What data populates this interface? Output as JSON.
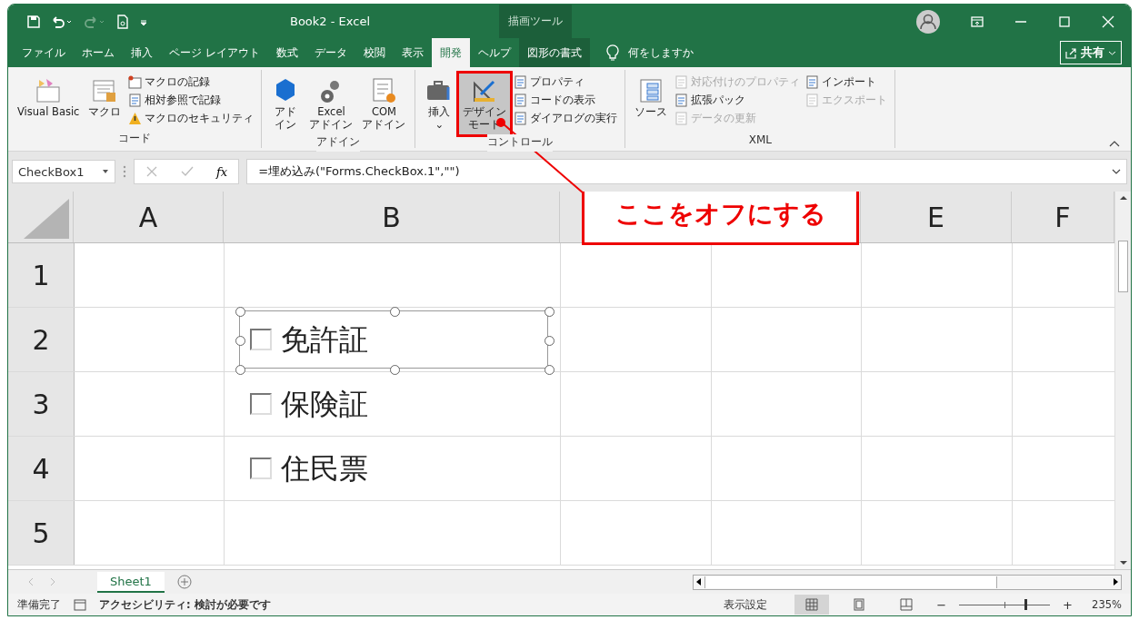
{
  "title_bar": {
    "title": "Book2  -  Excel",
    "context_tab": "描画ツール"
  },
  "menu_tabs": [
    {
      "label": "ファイル",
      "selected": false
    },
    {
      "label": "ホーム",
      "selected": false
    },
    {
      "label": "挿入",
      "selected": false
    },
    {
      "label": "ページ レイアウト",
      "selected": false
    },
    {
      "label": "数式",
      "selected": false
    },
    {
      "label": "データ",
      "selected": false
    },
    {
      "label": "校閲",
      "selected": false
    },
    {
      "label": "表示",
      "selected": false
    },
    {
      "label": "開発",
      "selected": true
    },
    {
      "label": "ヘルプ",
      "selected": false
    },
    {
      "label": "図形の書式",
      "selected": false
    }
  ],
  "tell_me": "何をしますか",
  "share_button": "共有",
  "ribbon": [
    {
      "label": "コード",
      "items": [
        {
          "kind": "large",
          "lines": [
            "Visual Basic"
          ]
        },
        {
          "kind": "large",
          "lines": [
            "マクロ"
          ]
        },
        {
          "kind": "stack",
          "entries": [
            {
              "label": "マクロの記録",
              "disabled": false
            },
            {
              "label": "相対参照で記録",
              "disabled": false
            },
            {
              "label": "マクロのセキュリティ",
              "disabled": false
            }
          ]
        }
      ]
    },
    {
      "label": "アドイン",
      "items": [
        {
          "kind": "large",
          "lines": [
            "アド",
            "イン"
          ]
        },
        {
          "kind": "large",
          "lines": [
            "Excel",
            "アドイン"
          ]
        },
        {
          "kind": "large",
          "lines": [
            "COM",
            "アドイン"
          ]
        }
      ]
    },
    {
      "label": "コントロール",
      "items": [
        {
          "kind": "large",
          "lines": [
            "挿入",
            "⌄"
          ]
        },
        {
          "kind": "large",
          "lines": [
            "デザイン",
            "モード"
          ],
          "selected": true
        },
        {
          "kind": "stack",
          "entries": [
            {
              "label": "プロパティ",
              "disabled": false
            },
            {
              "label": "コードの表示",
              "disabled": false
            },
            {
              "label": "ダイアログの実行",
              "disabled": false
            }
          ]
        }
      ]
    },
    {
      "label": "XML",
      "items": [
        {
          "kind": "large",
          "lines": [
            "ソース"
          ]
        },
        {
          "kind": "stack",
          "entries": [
            {
              "label": "対応付けのプロパティ",
              "disabled": true
            },
            {
              "label": "拡張パック",
              "disabled": false
            },
            {
              "label": "データの更新",
              "disabled": true
            }
          ]
        },
        {
          "kind": "stack",
          "entries": [
            {
              "label": "インポート",
              "disabled": false
            },
            {
              "label": "エクスポート",
              "disabled": true
            }
          ]
        }
      ]
    }
  ],
  "formula_bar": {
    "name_box": "CheckBox1",
    "fx": "fx",
    "formula": "=埋め込み(\"Forms.CheckBox.1\",\"\")"
  },
  "columns": [
    {
      "label": "A"
    },
    {
      "label": "B"
    },
    {},
    {},
    {
      "label": "E"
    },
    {
      "label": "F"
    }
  ],
  "rows": [
    {
      "label": "1"
    },
    {
      "label": "2",
      "checkbox": {
        "label": "免許証",
        "checked": false,
        "selected": true
      }
    },
    {
      "label": "3",
      "checkbox": {
        "label": "保険証",
        "checked": false,
        "selected": false
      }
    },
    {
      "label": "4",
      "checkbox": {
        "label": "住民票",
        "checked": false,
        "selected": false
      }
    },
    {
      "label": "5"
    }
  ],
  "callout": "ここをオフにする",
  "sheet_tabs": [
    {
      "label": "Sheet1",
      "selected": true
    }
  ],
  "status_bar": {
    "ready": "準備完了",
    "accessibility": "アクセシビリティ: 検討が必要です",
    "display_settings": "表示設定",
    "views": [
      {
        "kind": "normal",
        "selected": true
      },
      {
        "kind": "layout",
        "selected": false
      },
      {
        "kind": "pagebreak",
        "selected": false
      }
    ],
    "zoom": {
      "level": 0.72,
      "minus": "−",
      "plus": "+",
      "reading": "235%"
    }
  }
}
